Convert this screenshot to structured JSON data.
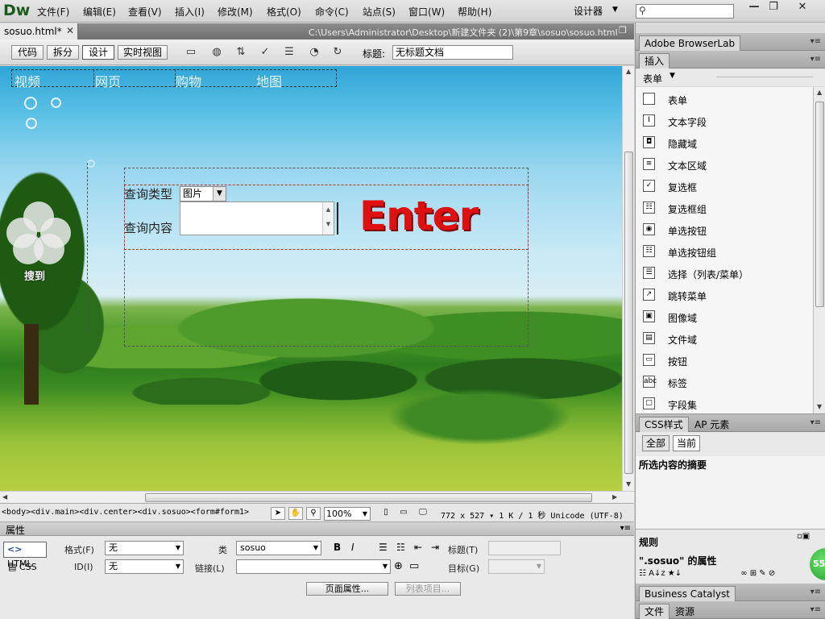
{
  "app": {
    "logo": "Dw",
    "menus": [
      "文件(F)",
      "编辑(E)",
      "查看(V)",
      "插入(I)",
      "修改(M)",
      "格式(O)",
      "命令(C)",
      "站点(S)",
      "窗口(W)",
      "帮助(H)"
    ],
    "workspace": "设计器",
    "window_buttons": [
      "—",
      "❐",
      "✕"
    ]
  },
  "document": {
    "tab_label": "sosuo.html*",
    "path": "C:\\Users\\Administrator\\Desktop\\新建文件夹 (2)\\第9章\\sosuo\\sosuo.html"
  },
  "toolbar": {
    "views": [
      "代码",
      "拆分",
      "设计",
      "实时视图"
    ],
    "active_view": "设计",
    "title_label": "标题:",
    "title_value": "无标题文档"
  },
  "page": {
    "nav": [
      "视频",
      "网页",
      "购物",
      "地图"
    ],
    "logo_text": "搜到",
    "query_type_label": "查询类型",
    "query_type_value": "图片",
    "query_content_label": "查询内容",
    "enter_text": "Enter"
  },
  "status": {
    "tag_path": "<body><div.main><div.center><div.sosuo><form#form1>",
    "zoom": "100%",
    "info": "772 x 527 ▾  1 K / 1 秒  Unicode (UTF-8)"
  },
  "properties": {
    "title": "属性",
    "html_label": "HTML",
    "css_label": "CSS",
    "format_label": "格式(F)",
    "format_value": "无",
    "id_label": "ID(I)",
    "id_value": "无",
    "class_label": "类",
    "class_value": "sosuo",
    "link_label": "链接(L)",
    "title_field_label": "标题(T)",
    "target_label": "目标(G)",
    "bold": "B",
    "italic": "I",
    "page_props_btn": "页面属性...",
    "list_item_btn": "列表项目..."
  },
  "right_panel": {
    "browserlab_tab": "Adobe BrowserLab",
    "insert_tab": "插入",
    "insert_category": "表单",
    "insert_items": [
      {
        "icon": "form-icon",
        "glyph": "",
        "label": "表单"
      },
      {
        "icon": "text-field-icon",
        "glyph": "I",
        "label": "文本字段"
      },
      {
        "icon": "hidden-field-icon",
        "glyph": "◘",
        "label": "隐藏域"
      },
      {
        "icon": "textarea-icon",
        "glyph": "≡",
        "label": "文本区域"
      },
      {
        "icon": "checkbox-icon",
        "glyph": "✓",
        "label": "复选框"
      },
      {
        "icon": "checkbox-group-icon",
        "glyph": "☷",
        "label": "复选框组"
      },
      {
        "icon": "radio-icon",
        "glyph": "◉",
        "label": "单选按钮"
      },
      {
        "icon": "radio-group-icon",
        "glyph": "☷",
        "label": "单选按钮组"
      },
      {
        "icon": "select-icon",
        "glyph": "☰",
        "label": "选择（列表/菜单）"
      },
      {
        "icon": "jump-menu-icon",
        "glyph": "↗",
        "label": "跳转菜单"
      },
      {
        "icon": "image-field-icon",
        "glyph": "▣",
        "label": "图像域"
      },
      {
        "icon": "file-field-icon",
        "glyph": "▤",
        "label": "文件域"
      },
      {
        "icon": "button-icon",
        "glyph": "▭",
        "label": "按钮"
      },
      {
        "icon": "label-icon",
        "glyph": "abc",
        "label": "标签"
      },
      {
        "icon": "fieldset-icon",
        "glyph": "▢",
        "label": "字段集"
      }
    ],
    "css_tab": "CSS样式",
    "ap_tab": "AP 元素",
    "all_btn": "全部",
    "current_btn": "当前",
    "summary_title": "所选内容的摘要",
    "rules_title": "规则",
    "props_title": "\".sosuo\" 的属性",
    "badge": "55",
    "bc_tab": "Business Catalyst",
    "files_tab": "文件",
    "assets_tab": "资源"
  }
}
